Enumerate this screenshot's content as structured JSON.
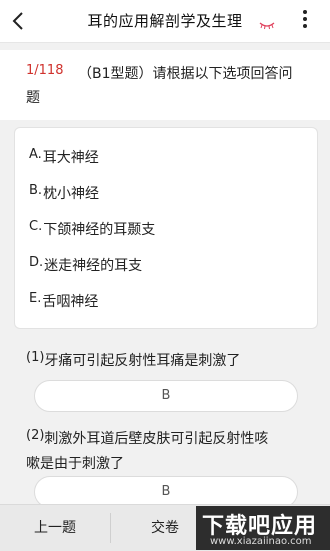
{
  "header": {
    "title": "耳的应用解剖学及生理",
    "back_icon": "chevron-left-icon",
    "eye_icon": "eye-closed-icon",
    "more_icon": "more-vertical-icon"
  },
  "question": {
    "number": "1/118",
    "text_line1": "（B1型题）请根据以下选项回答问",
    "text_line2": "题"
  },
  "options": [
    {
      "letter": "A.",
      "text": "耳大神经"
    },
    {
      "letter": "B.",
      "text": "枕小神经"
    },
    {
      "letter": "C.",
      "text": "下颌神经的耳颞支"
    },
    {
      "letter": "D.",
      "text": "迷走神经的耳支"
    },
    {
      "letter": "E.",
      "text": "舌咽神经"
    }
  ],
  "subquestions": [
    {
      "num": "(1)",
      "text": "牙痛可引起反射性耳痛是刺激了",
      "answer": "B"
    },
    {
      "num": "(2)",
      "text_line1": "刺激外耳道后壁皮肤可引起反射性咳",
      "text_line2": "嗽是由于刺激了",
      "answer": "B"
    }
  ],
  "bottom": {
    "prev_label": "上一题",
    "submit_label": "交卷"
  },
  "watermark": {
    "title": "下载吧应用",
    "url": "www.xiazaiinao.com"
  },
  "colors": {
    "accent_red": "#d0322d",
    "eye_pink": "#e0405c"
  }
}
